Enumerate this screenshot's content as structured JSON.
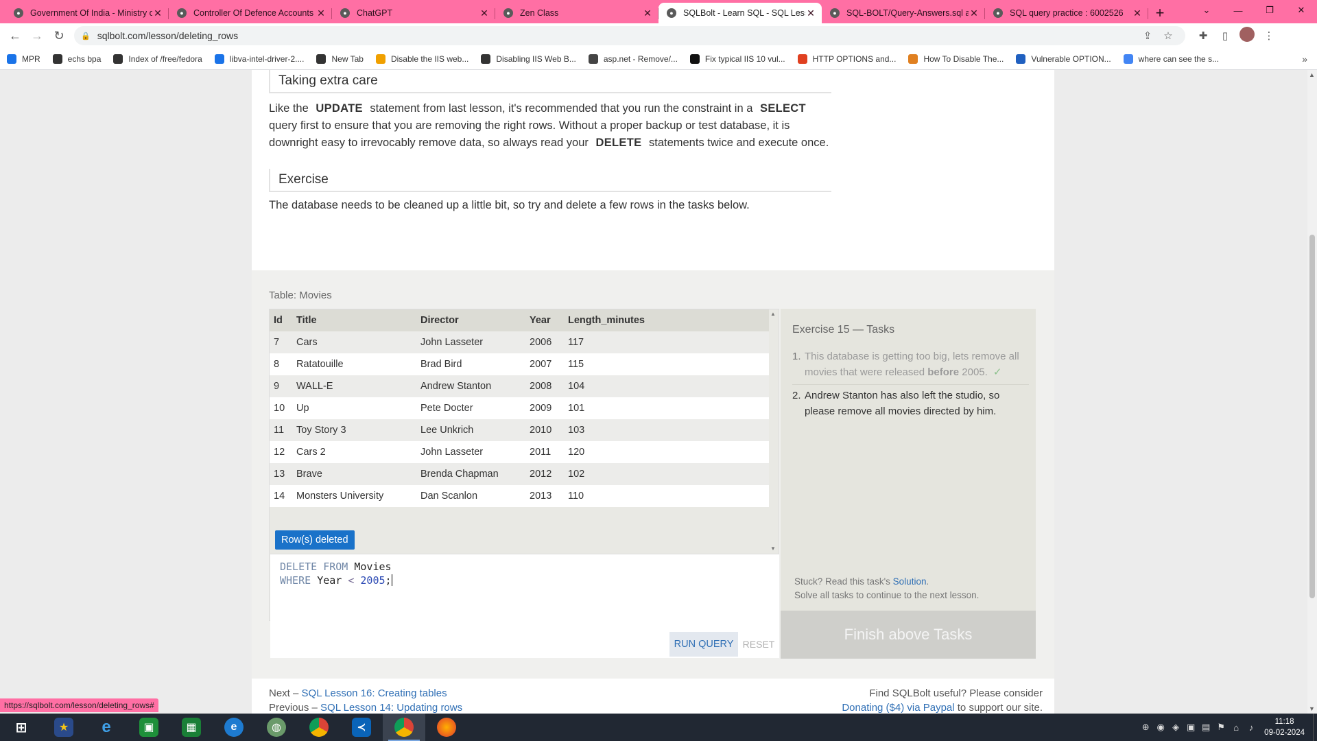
{
  "browser": {
    "tabs": [
      {
        "title": "Government Of India - Ministry o",
        "active": false
      },
      {
        "title": "Controller Of Defence Accounts",
        "active": false
      },
      {
        "title": "ChatGPT",
        "active": false
      },
      {
        "title": "Zen Class",
        "active": false
      },
      {
        "title": "SQLBolt - Learn SQL - SQL Lesso",
        "active": true
      },
      {
        "title": "SQL-BOLT/Query-Answers.sql at",
        "active": false
      },
      {
        "title": "SQL query practice : 6002526",
        "active": false
      }
    ],
    "url": "sqlbolt.com/lesson/deleting_rows",
    "bookmarks": [
      {
        "label": "MPR",
        "color": "#1a73e8"
      },
      {
        "label": "echs bpa",
        "color": "#333333"
      },
      {
        "label": "Index of /free/fedora",
        "color": "#333333"
      },
      {
        "label": "libva-intel-driver-2....",
        "color": "#1a73e8"
      },
      {
        "label": "New Tab",
        "color": "#333333"
      },
      {
        "label": "Disable the IIS web...",
        "color": "#f0a000"
      },
      {
        "label": "Disabling IIS Web B...",
        "color": "#333333"
      },
      {
        "label": "asp.net - Remove/...",
        "color": "#444444"
      },
      {
        "label": "Fix typical IIS 10 vul...",
        "color": "#111111"
      },
      {
        "label": "HTTP OPTIONS and...",
        "color": "#e04020"
      },
      {
        "label": "How To Disable The...",
        "color": "#e08020"
      },
      {
        "label": "Vulnerable OPTION...",
        "color": "#2060c0"
      },
      {
        "label": "where can see the s...",
        "color": "#4285f4"
      }
    ],
    "status_url": "https://sqlbolt.com/lesson/deleting_rows#"
  },
  "lesson": {
    "heading_extra_care": "Taking extra care",
    "para_extra_care": {
      "p1": "Like the",
      "kw1": "UPDATE",
      "p2": "statement from last lesson, it's recommended that you run the constraint in a",
      "kw2": "SELECT",
      "p3": "query first to ensure that you are removing the right rows. Without a proper backup or test database, it is downright easy to irrevocably remove data, so always read your",
      "kw3": "DELETE",
      "p4": "statements twice and execute once."
    },
    "heading_exercise": "Exercise",
    "para_exercise": "The database needs to be cleaned up a little bit, so try and delete a few rows in the tasks below."
  },
  "table": {
    "label": "Table: Movies",
    "columns": [
      "Id",
      "Title",
      "Director",
      "Year",
      "Length_minutes"
    ],
    "rows": [
      [
        "7",
        "Cars",
        "John Lasseter",
        "2006",
        "117"
      ],
      [
        "8",
        "Ratatouille",
        "Brad Bird",
        "2007",
        "115"
      ],
      [
        "9",
        "WALL-E",
        "Andrew Stanton",
        "2008",
        "104"
      ],
      [
        "10",
        "Up",
        "Pete Docter",
        "2009",
        "101"
      ],
      [
        "11",
        "Toy Story 3",
        "Lee Unkrich",
        "2010",
        "103"
      ],
      [
        "12",
        "Cars 2",
        "John Lasseter",
        "2011",
        "120"
      ],
      [
        "13",
        "Brave",
        "Brenda Chapman",
        "2012",
        "102"
      ],
      [
        "14",
        "Monsters University",
        "Dan Scanlon",
        "2013",
        "110"
      ]
    ],
    "status": "Row(s) deleted"
  },
  "editor": {
    "line1_kw": "DELETE FROM",
    "line1_id": "Movies",
    "line2_kw": "WHERE",
    "line2_id": "Year",
    "line2_op": "<",
    "line2_num": "2005",
    "line2_end": ";",
    "run_label": "RUN QUERY",
    "reset_label": "RESET"
  },
  "tasks": {
    "title": "Exercise 15 — Tasks",
    "items": [
      {
        "num": "1.",
        "pre": "This database is getting too big, lets remove all movies that were released",
        "bold": "before",
        "post": "2005.",
        "done": true
      },
      {
        "num": "2.",
        "text": "Andrew Stanton has also left the studio, so please remove all movies directed by him.",
        "done": false
      }
    ],
    "stuck_text": "Stuck? Read this task's",
    "solution_link": "Solution",
    "solve_all": "Solve all tasks to continue to the next lesson.",
    "finish_label": "Finish above Tasks"
  },
  "footer": {
    "next_prefix": "Next –",
    "next_link": "SQL Lesson 16: Creating tables",
    "prev_prefix": "Previous –",
    "prev_link": "SQL Lesson 14: Updating rows",
    "donate_text": "Find SQLBolt useful? Please consider",
    "donate_link": "Donating ($4) via Paypal",
    "donate_suffix": "to support our site."
  },
  "taskbar": {
    "time": "11:18",
    "date": "09-02-2024",
    "apps": [
      "windows-start",
      "star-app",
      "internet-explorer",
      "excel-green",
      "calculator",
      "edge",
      "globe-app",
      "chrome",
      "vscode",
      "chrome-active",
      "firefox"
    ]
  }
}
